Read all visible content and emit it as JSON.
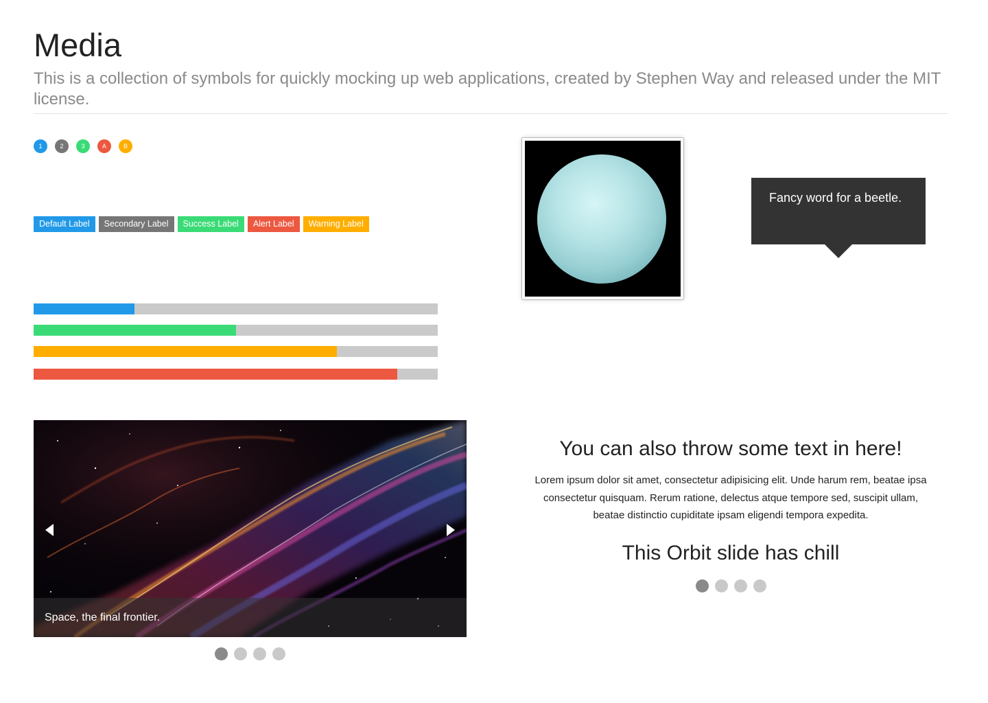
{
  "page": {
    "title": "Media",
    "subtitle": "This is a collection of symbols for quickly mocking up web applications, created by Stephen Way and released under the MIT license."
  },
  "badges": [
    {
      "text": "1",
      "color": "#2199e8"
    },
    {
      "text": "2",
      "color": "#767676"
    },
    {
      "text": "3",
      "color": "#3adb76"
    },
    {
      "text": "A",
      "color": "#ec5840"
    },
    {
      "text": "B",
      "color": "#ffae00"
    }
  ],
  "labels": [
    {
      "text": "Default Label",
      "color": "#2199e8"
    },
    {
      "text": "Secondary Label",
      "color": "#767676"
    },
    {
      "text": "Success Label",
      "color": "#3adb76"
    },
    {
      "text": "Alert Label",
      "color": "#ec5840"
    },
    {
      "text": "Warning Label",
      "color": "#ffae00"
    }
  ],
  "progress_bars": [
    {
      "value": 0.25,
      "color": "#2199e8"
    },
    {
      "value": 0.5,
      "color": "#3adb76"
    },
    {
      "value": 0.75,
      "color": "#ffae00"
    },
    {
      "value": 0.9,
      "color": "#ec5840"
    }
  ],
  "thumbnail": {
    "alt": "planet-image"
  },
  "tooltip": {
    "text": "Fancy word for a beetle."
  },
  "orbit_image": {
    "caption": "Space, the final frontier.",
    "slide_count": 4,
    "active_slide": 1
  },
  "orbit_text": {
    "heading": "You can also throw some text in here!",
    "body": "Lorem ipsum dolor sit amet, consectetur adipisicing elit. Unde harum rem, beatae ipsa consectetur quisquam. Rerum ratione, delectus atque tempore sed, suscipit ullam, beatae distinctio cupiditate ipsam eligendi tempora expedita.",
    "subheading": "This Orbit slide has chill",
    "slide_count": 4,
    "active_slide": 1
  }
}
